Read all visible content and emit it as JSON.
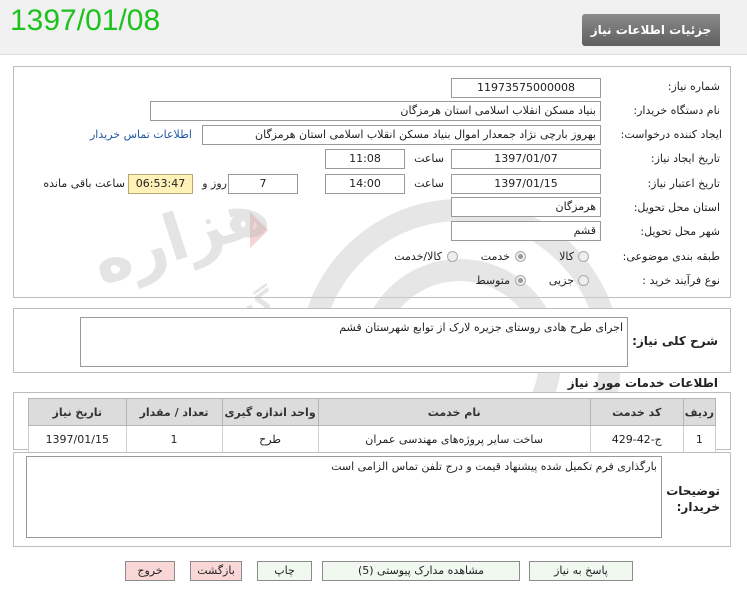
{
  "header": {
    "title": "جزئیات اطلاعات نیاز",
    "date_big": "1397/01/08"
  },
  "form": {
    "need_number_label": "شماره نیاز:",
    "need_number": "11973575000008",
    "buyer_label": "نام دستگاه خریدار:",
    "buyer": "بنیاد مسکن انقلاب اسلامی استان هرمزگان",
    "creator_label": "ایجاد کننده درخواست:",
    "creator": "بهروز  بارچی نژاد جمعدار اموال بنیاد مسکن انقلاب اسلامی استان هرمزگان",
    "contact_link": "اطلاعات تماس خریدار",
    "created_label": "تاریخ ایجاد نیاز:",
    "created_date": "1397/01/07",
    "time_label": "ساعت",
    "created_time": "11:08",
    "validity_label": "تاریخ اعتبار نیاز:",
    "validity_date": "1397/01/15",
    "validity_time": "14:00",
    "days": "7",
    "days_label": "روز و",
    "remaining": "06:53:47",
    "remaining_label": "ساعت باقی مانده",
    "province_label": "استان محل تحویل:",
    "province": "هرمزگان",
    "city_label": "شهر محل تحویل:",
    "city": "قشم",
    "category_label": "طبقه بندی موضوعی:",
    "category_options": [
      "کالا",
      "خدمت",
      "کالا/خدمت"
    ],
    "category_selected": "خدمت",
    "process_label": "نوع فرآیند خرید :",
    "process_options": [
      "جزیی",
      "متوسط"
    ],
    "process_selected": "متوسط"
  },
  "summary": {
    "label": "شرح کلی نیاز:",
    "text": "اجرای  طرح هادی روستای جزیره لارک  از توابع شهرستان قشم"
  },
  "services": {
    "title": "اطلاعات خدمات مورد نیاز",
    "columns": [
      "ردیف",
      "کد خدمت",
      "نام خدمت",
      "واحد اندازه گیری",
      "تعداد / مقدار",
      "تاریخ نیاز"
    ],
    "rows": [
      [
        "1",
        "ج-42-429",
        "ساخت سایر پروژه‌های مهندسی عمران",
        "طرح",
        "1",
        "1397/01/15"
      ]
    ]
  },
  "notes": {
    "label": "توضیحات خریدار:",
    "text": "بارگذاری فرم تکمیل شده پیشنهاد قیمت و درج تلفن تماس الزامی است"
  },
  "buttons": {
    "reply": "پاسخ به نیاز",
    "attachments": "مشاهده مدارک پیوستی (5)",
    "print": "چاپ",
    "back": "بازگشت",
    "exit": "خروج"
  }
}
